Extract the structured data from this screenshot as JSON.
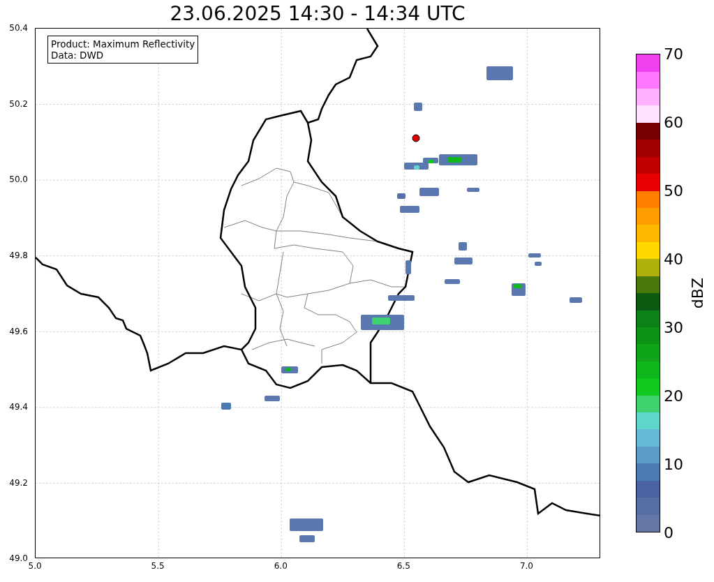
{
  "title": "23.06.2025 14:30 - 14:34 UTC",
  "info_box": {
    "product": "Product: Maximum Reflectivity",
    "data": "Data: DWD"
  },
  "y_ticks": [
    "50.4",
    "50.2",
    "50.0",
    "49.8",
    "49.6",
    "49.4",
    "49.2",
    "49.0"
  ],
  "x_ticks": [
    "5.0",
    "5.5",
    "6.0",
    "6.5",
    "7.0"
  ],
  "colorbar": {
    "label": "dBZ",
    "ticks": [
      "70",
      "60",
      "50",
      "40",
      "30",
      "20",
      "10",
      "0"
    ],
    "bands": [
      {
        "color": "#6577a6"
      },
      {
        "color": "#586fa3"
      },
      {
        "color": "#4a62a0"
      },
      {
        "color": "#4a7ab0"
      },
      {
        "color": "#5b9bc8"
      },
      {
        "color": "#65bad8"
      },
      {
        "color": "#60d7cc"
      },
      {
        "color": "#3ed36f"
      },
      {
        "color": "#10c81e"
      },
      {
        "color": "#10b71c"
      },
      {
        "color": "#10a518"
      },
      {
        "color": "#0e9317"
      },
      {
        "color": "#0d8116"
      },
      {
        "color": "#0b5c12"
      },
      {
        "color": "#4a7a0c"
      },
      {
        "color": "#b0b00c"
      },
      {
        "color": "#ffd800"
      },
      {
        "color": "#ffb800"
      },
      {
        "color": "#ff9e00"
      },
      {
        "color": "#ff8000"
      },
      {
        "color": "#e80000"
      },
      {
        "color": "#c00000"
      },
      {
        "color": "#a00000"
      },
      {
        "color": "#780000"
      },
      {
        "color": "#ffe0ff"
      },
      {
        "color": "#ffb0ff"
      },
      {
        "color": "#ff78ff"
      },
      {
        "color": "#f040f0"
      }
    ]
  }
}
